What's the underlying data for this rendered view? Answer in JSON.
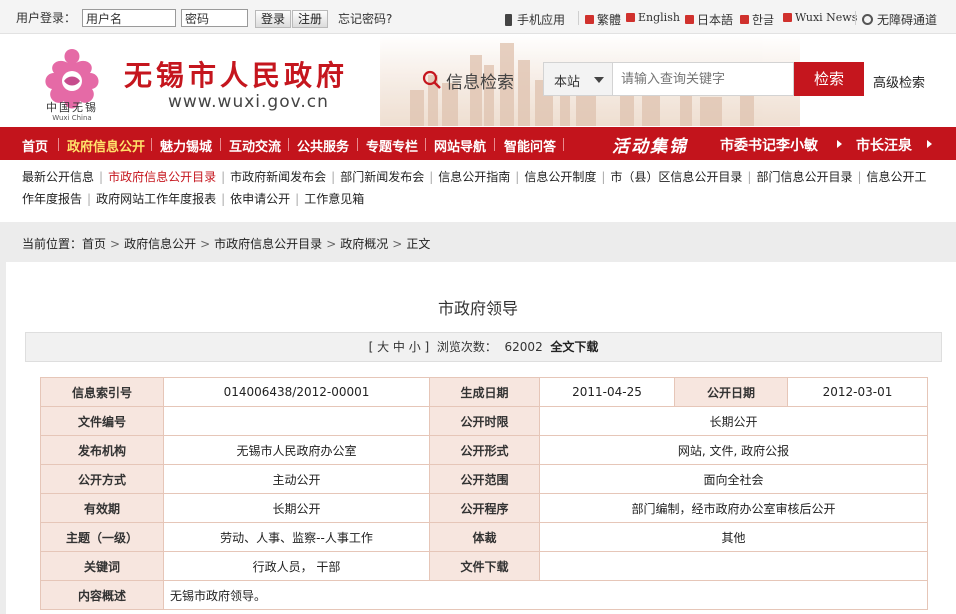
{
  "topbar": {
    "login_label": "用户登录：",
    "username_placeholder": "用户名",
    "password_placeholder": "密码",
    "login_btn": "登录",
    "register_btn": "注册",
    "forgot": "忘记密码?",
    "mobile": "手机应用",
    "trad": "繁體",
    "english": "English",
    "japanese": "日本語",
    "korean": "한글",
    "wuxi_news": "Wuxi News",
    "accessible": "无障碍通道"
  },
  "header": {
    "logo_text": "中国无锡",
    "logo_sub": "Wuxi China",
    "site_title": "无锡市人民政府",
    "site_url": "www.wuxi.gov.cn",
    "search_label": "信息检索",
    "scope_value": "本站",
    "query_placeholder": "请输入查询关键字",
    "search_btn": "检索",
    "advanced": "高级检索",
    "brand_color": "#c5161e"
  },
  "nav": {
    "items": [
      "首页",
      "政府信息公开",
      "魅力锡城",
      "互动交流",
      "公共服务",
      "专题专栏",
      "网站导航",
      "智能问答"
    ],
    "active_index": 1,
    "promo": "活动集锦",
    "leaders": [
      "市委书记李小敏",
      "市长汪泉"
    ]
  },
  "subnav": {
    "row1": [
      "最新公开信息",
      "市政府信息公开目录",
      "市政府新闻发布会",
      "部门新闻发布会",
      "信息公开指南",
      "信息公开制度",
      "市（县）区信息公开目录",
      "部门信息公开目录",
      "信息公开工"
    ],
    "row2": [
      "作年度报告",
      "政府网站工作年度报表",
      "依申请公开",
      "工作意见箱"
    ],
    "active_index": 1
  },
  "breadcrumb": {
    "label": "当前位置：",
    "items": [
      "首页",
      "政府信息公开",
      "市政府信息公开目录",
      "政府概况",
      "正文"
    ]
  },
  "article": {
    "title": "市政府领导",
    "font_size_label": "[ 大 中 小 ]",
    "views_label": "浏览次数：",
    "views": "62002",
    "download_all": "全文下载"
  },
  "info": {
    "index_no_k": "信息索引号",
    "index_no_v": "014006438/2012-00001",
    "gen_date_k": "生成日期",
    "gen_date_v": "2011-04-25",
    "pub_date_k": "公开日期",
    "pub_date_v": "2012-03-01",
    "doc_no_k": "文件编号",
    "doc_no_v": "",
    "limit_k": "公开时限",
    "limit_v": "长期公开",
    "issuer_k": "发布机构",
    "issuer_v": "无锡市人民政府办公室",
    "form_k": "公开形式",
    "form_v": "网站, 文件, 政府公报",
    "method_k": "公开方式",
    "method_v": "主动公开",
    "scope_k": "公开范围",
    "scope_v": "面向全社会",
    "valid_k": "有效期",
    "valid_v": "长期公开",
    "proc_k": "公开程序",
    "proc_v": "部门编制，经市政府办公室审核后公开",
    "topic_k": "主题（一级）",
    "topic_v": "劳动、人事、监察--人事工作",
    "genre_k": "体裁",
    "genre_v": "其他",
    "keywords_k": "关键词",
    "keywords_v": "行政人员， 干部",
    "filedl_k": "文件下载",
    "filedl_v": "",
    "summary_k": "内容概述",
    "summary_v": "无锡市政府领导。"
  }
}
